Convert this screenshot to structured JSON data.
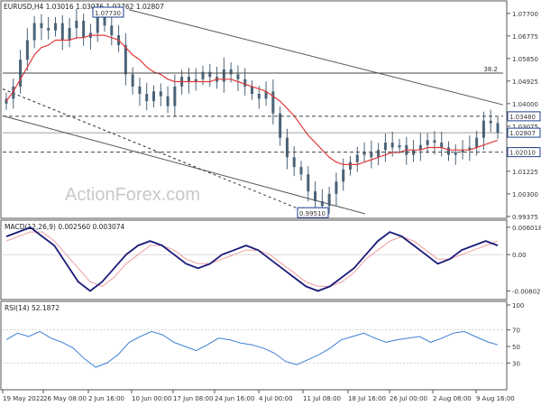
{
  "header": {
    "symbol_info": "EURUSD,H4  1.03016 1.03076 1.02762 1.02807",
    "macd_info": "MACD(12,26,9) 0.002560 0.003074",
    "rsi_info": "RSI(14) 52.1872",
    "watermark": "ActionForex.com"
  },
  "colors": {
    "candles": "#4a6378",
    "sma": "#e23a3a",
    "channel": "#4d5a55",
    "macd_line": "#1a1a7a",
    "macd_signal": "#f0a0a0",
    "rsi": "#3b7fd6",
    "label_box": "#1d3f8f"
  },
  "chart_data": [
    {
      "type": "candlestick",
      "name": "price",
      "ylim": [
        0.9937,
        1.081
      ],
      "yticks": [
        "1.07700",
        "1.06775",
        "1.05850",
        "1.04925",
        "1.04000",
        "1.03075",
        "1.02150",
        "1.01225",
        "1.00300",
        "0.99375"
      ],
      "close_series": [
        1.042,
        1.047,
        1.058,
        1.066,
        1.073,
        1.071,
        1.07,
        1.073,
        1.066,
        1.071,
        1.074,
        1.067,
        1.069,
        1.076,
        1.072,
        1.068,
        1.064,
        1.052,
        1.047,
        1.044,
        1.041,
        1.045,
        1.043,
        1.039,
        1.047,
        1.051,
        1.049,
        1.05,
        1.053,
        1.051,
        1.049,
        1.054,
        1.052,
        1.05,
        1.047,
        1.044,
        1.042,
        1.045,
        1.036,
        1.026,
        1.018,
        1.014,
        1.011,
        1.004,
        1.0,
        0.998,
        1.003,
        1.008,
        1.013,
        1.016,
        1.019,
        1.02,
        1.018,
        1.021,
        1.024,
        1.022,
        1.023,
        1.019,
        1.021,
        1.023,
        1.025,
        1.024,
        1.022,
        1.019,
        1.02,
        1.021,
        1.022,
        1.026,
        1.033,
        1.032,
        1.028
      ],
      "sma_series": [
        1.041,
        1.045,
        1.05,
        1.055,
        1.06,
        1.063,
        1.064,
        1.066,
        1.066,
        1.066,
        1.067,
        1.067,
        1.068,
        1.068,
        1.068,
        1.067,
        1.066,
        1.063,
        1.06,
        1.058,
        1.055,
        1.053,
        1.052,
        1.05,
        1.049,
        1.049,
        1.049,
        1.049,
        1.049,
        1.049,
        1.05,
        1.05,
        1.05,
        1.049,
        1.048,
        1.047,
        1.046,
        1.045,
        1.043,
        1.041,
        1.038,
        1.035,
        1.031,
        1.027,
        1.024,
        1.021,
        1.018,
        1.016,
        1.015,
        1.015,
        1.015,
        1.016,
        1.017,
        1.018,
        1.019,
        1.02,
        1.02,
        1.021,
        1.021,
        1.021,
        1.022,
        1.022,
        1.022,
        1.021,
        1.021,
        1.021,
        1.021,
        1.022,
        1.023,
        1.024,
        1.025
      ],
      "levels": [
        {
          "value": 1.0348,
          "label": "1.03480",
          "style": "dashed",
          "boxed": true
        },
        {
          "value": 1.0201,
          "label": "1.02010",
          "style": "dashed",
          "boxed": true
        },
        {
          "value": 1.02807,
          "label": "1.02807",
          "style": "solid-thin",
          "boxed": true
        },
        {
          "value": 1.0525,
          "label": "38.2",
          "style": "solid",
          "boxed": false
        }
      ],
      "annotations": [
        "1.07730",
        "0.99510"
      ],
      "xlabels": [
        "19 May 2022",
        "26 May 08:00",
        "2 Jun 16:00",
        "10 Jun 00:00",
        "17 Jun 08:00",
        "24 Jun 16:00",
        "4 Jul 00:00",
        "11 Jul 08:00",
        "18 Jul 16:00",
        "26 Jul 00:00",
        "2 Aug 08:00",
        "9 Aug 16:00"
      ]
    },
    {
      "type": "line",
      "name": "MACD(12,26,9)",
      "ylim": [
        -0.0095,
        0.0068
      ],
      "yticks": [
        "0.006018",
        "0.00",
        "-0.00802"
      ],
      "macd_series": [
        0.004,
        0.005,
        0.006,
        0.004,
        0.002,
        -0.002,
        -0.006,
        -0.008,
        -0.006,
        -0.003,
        0.0,
        0.002,
        0.003,
        0.002,
        0.0,
        -0.002,
        -0.003,
        -0.002,
        0.0,
        0.001,
        0.002,
        0.001,
        -0.001,
        -0.003,
        -0.005,
        -0.007,
        -0.008,
        -0.007,
        -0.005,
        -0.003,
        0.0,
        0.003,
        0.005,
        0.004,
        0.002,
        0.0,
        -0.002,
        -0.001,
        0.001,
        0.002,
        0.003,
        0.002
      ],
      "signal_series": [
        0.003,
        0.004,
        0.005,
        0.005,
        0.003,
        0.0,
        -0.003,
        -0.006,
        -0.007,
        -0.005,
        -0.002,
        0.0,
        0.002,
        0.002,
        0.001,
        -0.001,
        -0.002,
        -0.002,
        -0.001,
        0.0,
        0.001,
        0.001,
        0.0,
        -0.002,
        -0.004,
        -0.006,
        -0.007,
        -0.007,
        -0.006,
        -0.004,
        -0.001,
        0.001,
        0.003,
        0.004,
        0.003,
        0.001,
        -0.001,
        -0.001,
        0.0,
        0.001,
        0.002,
        0.003
      ]
    },
    {
      "type": "line",
      "name": "RSI(14)",
      "ylim": [
        0,
        100
      ],
      "yticks": [
        "100",
        "70",
        "50",
        "30",
        "0"
      ],
      "rsi_series": [
        58,
        66,
        62,
        68,
        60,
        55,
        48,
        35,
        25,
        30,
        40,
        55,
        62,
        68,
        64,
        55,
        50,
        45,
        52,
        60,
        58,
        54,
        52,
        48,
        42,
        32,
        28,
        34,
        40,
        48,
        58,
        62,
        66,
        60,
        55,
        58,
        60,
        62,
        55,
        60,
        66,
        68,
        62,
        56,
        52
      ]
    }
  ]
}
